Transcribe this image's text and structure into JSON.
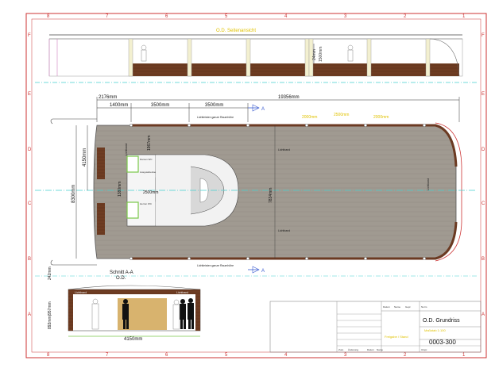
{
  "border": {
    "top_numbers": [
      "8",
      "7",
      "6",
      "5",
      "4",
      "3",
      "2",
      "1"
    ],
    "bottom_numbers": [
      "8",
      "7",
      "6",
      "5",
      "4",
      "3",
      "2",
      "1"
    ],
    "side_letters": [
      "F",
      "E",
      "D",
      "C",
      "B",
      "A"
    ]
  },
  "side_view": {
    "title": "O.D. Seitenansicht",
    "dim_height_a": "24mm",
    "dim_height_b": "1500mm"
  },
  "plan": {
    "dim_total": "19356mm",
    "dim_a": "2176mm",
    "dim_b": "1400mm",
    "dim_c": "3500mm",
    "dim_d": "3500mm",
    "dim_yellow_1": "2000mm",
    "dim_yellow_2": "2500mm",
    "dim_yellow_3": "2000mm",
    "dim_width_outer": "4150mm",
    "dim_width_total": "8300mm",
    "dim_width_inner": "1967mm",
    "dim_stair_w": "2500mm",
    "dim_stair_h": "1380mm",
    "dim_center": "7834mm",
    "section_marker": "A",
    "label_lights_top": "Lichtleisten ganze Raumhöhe",
    "label_lights_bottom": "Lichtleisten ganze Raumhöhe",
    "label_lichtband_1": "Lichtband",
    "label_lichtband_2": "Lichtband",
    "label_lichtband_3": "Lichtband",
    "label_lichtband_4": "Lichtband",
    "room_toilet_top": "Damen WC",
    "room_lift": "Aufzug mit Stauraum",
    "room_sink": "Ausgussbecken",
    "room_toilet_bottom": "Herren WC",
    "room_storage": "Putzraum",
    "room_stair": "Treppe"
  },
  "section": {
    "title": "Schnitt A-A",
    "subtitle": "O.D.",
    "dim_top": "242mm",
    "dim_side": "893mm|957mm",
    "dim_width": "4150mm",
    "label_left": "Lichtband",
    "label_right": "Lichtband"
  },
  "title_block": {
    "project": "O.D. Grundriss",
    "scale_text": "Maßstab 1:100",
    "drawing_no": "0003-300",
    "status": "Freigabe / Stand",
    "hdr_a": "Zust.",
    "hdr_b": "Änderung",
    "hdr_c": "Datum",
    "hdr_d": "Name",
    "rev_a": "Datum",
    "rev_b": "Name",
    "rev_c": "Gepr.",
    "rev_d": "Norm",
    "bottom_a": "Zust.",
    "bottom_b": "Änderung",
    "bottom_c": "Datum",
    "bottom_d": "Name",
    "bottom_e": "Urspr."
  },
  "colors": {
    "frame": "#cc3333",
    "deck": "#9a948c",
    "wood": "#6b3a22",
    "dim_line": "#333333",
    "accent_yellow": "#e0c200",
    "green_rooms": "#7ac84a",
    "blue_marker": "#3a5bd0",
    "cyan_line": "#44cfcf"
  }
}
